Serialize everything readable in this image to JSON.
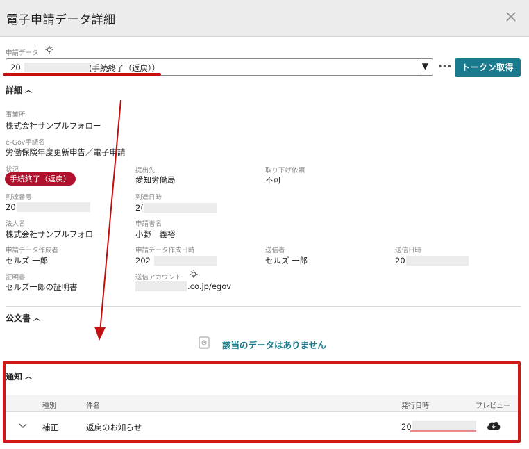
{
  "header": {
    "title": "電子申請データ詳細",
    "close_icon": "close-icon"
  },
  "application": {
    "label": "申請データ",
    "select_prefix": "20.",
    "select_suffix": "(手続終了（返戻））",
    "more_label": "•••",
    "token_button": "トークン取得",
    "tip_icon": "lightbulb-icon"
  },
  "details": {
    "section_label": "詳細",
    "office_label": "事業所",
    "office_value": "株式会社サンプルフォロー",
    "procedure_label": "e-Gov手続名",
    "procedure_value": "労働保険年度更新申告／電子申請",
    "status_label": "状況",
    "status_value": "手続終了（返戻）",
    "submit_to_label": "提出先",
    "submit_to_value": "愛知労働局",
    "withdraw_label": "取り下げ依頼",
    "withdraw_value": "不可",
    "arrival_no_label": "到達番号",
    "arrival_no_value": "20",
    "arrival_date_label": "到達日時",
    "arrival_date_value": "2(",
    "corp_label": "法人名",
    "corp_value": "株式会社サンプルフォロー",
    "applicant_label": "申請者名",
    "applicant_value": "小野　義裕",
    "creator_label": "申請データ作成者",
    "creator_value": "セルズ 一郎",
    "created_at_label": "申請データ作成日時",
    "created_at_value": "202",
    "sender_label": "送信者",
    "sender_value": "セルズ 一郎",
    "sent_at_label": "送信日時",
    "sent_at_value": "20",
    "cert_label": "証明書",
    "cert_value": "セルズ一郎の証明書",
    "account_label": "送信アカウント",
    "account_value": ".co.jp/egov"
  },
  "documents": {
    "section_label": "公文書",
    "empty_text": "該当のデータはありません"
  },
  "notices": {
    "section_label": "通知",
    "columns": {
      "type": "種別",
      "subject": "件名",
      "issued": "発行日時",
      "preview": "プレビュー"
    },
    "rows": [
      {
        "type": "補正",
        "subject": "返戻のお知らせ",
        "issued": "20"
      }
    ]
  },
  "colors": {
    "accent": "#197a8e",
    "status_badge": "#b0122d",
    "annotation_red": "#d01818"
  }
}
